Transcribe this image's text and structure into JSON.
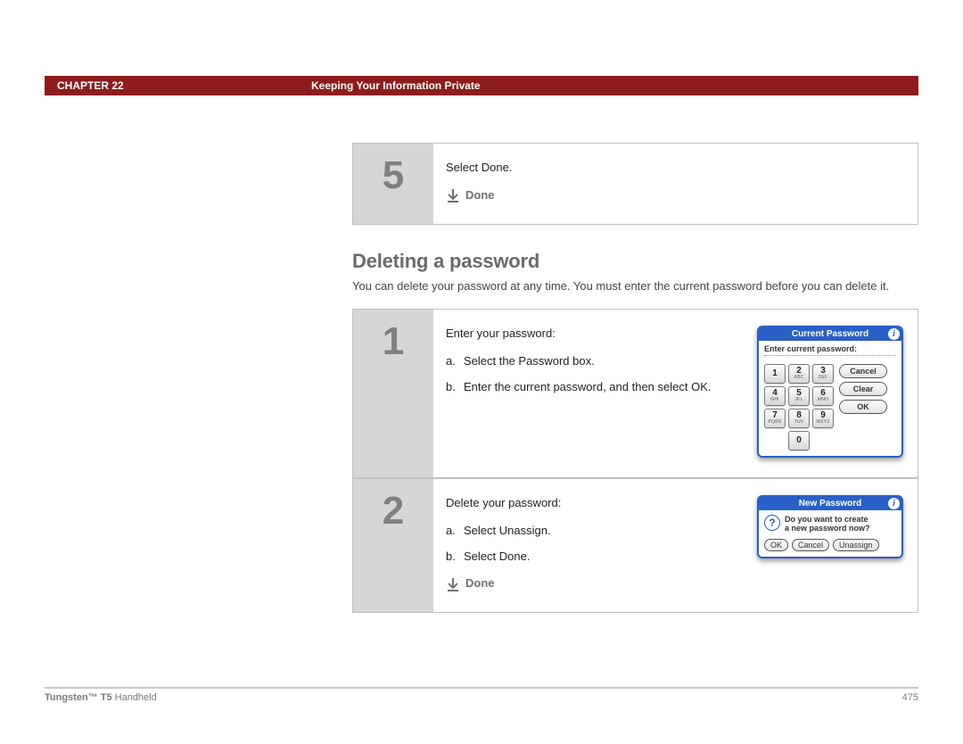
{
  "header": {
    "chapter": "CHAPTER 22",
    "title": "Keeping Your Information Private"
  },
  "step5": {
    "num": "5",
    "text": "Select Done.",
    "done_label": "Done"
  },
  "section": {
    "heading": "Deleting a password",
    "intro": "You can delete your password at any time. You must enter the current password before you can delete it."
  },
  "step1": {
    "num": "1",
    "lead": "Enter your password:",
    "a": "Select the Password box.",
    "b": "Enter the current password, and then select OK."
  },
  "step2": {
    "num": "2",
    "lead": "Delete your password:",
    "a": "Select Unassign.",
    "b": "Select Done.",
    "done_label": "Done"
  },
  "palm_current": {
    "title": "Current Password",
    "prompt": "Enter current password:",
    "keys": {
      "k1": {
        "d": "1",
        "l": ""
      },
      "k2": {
        "d": "2",
        "l": "ABC"
      },
      "k3": {
        "d": "3",
        "l": "DEF"
      },
      "k4": {
        "d": "4",
        "l": "GHI"
      },
      "k5": {
        "d": "5",
        "l": "JKL"
      },
      "k6": {
        "d": "6",
        "l": "MNO"
      },
      "k7": {
        "d": "7",
        "l": "PQRS"
      },
      "k8": {
        "d": "8",
        "l": "TUV"
      },
      "k9": {
        "d": "9",
        "l": "WXYZ"
      },
      "k0": {
        "d": "0",
        "l": ""
      }
    },
    "buttons": {
      "cancel": "Cancel",
      "clear": "Clear",
      "ok": "OK"
    }
  },
  "palm_new": {
    "title": "New Password",
    "msg1": "Do you want to create",
    "msg2": "a new password now?",
    "buttons": {
      "ok": "OK",
      "cancel": "Cancel",
      "unassign": "Unassign"
    }
  },
  "footer": {
    "product_bold": "Tungsten™ T5",
    "product_rest": " Handheld",
    "page": "475"
  }
}
